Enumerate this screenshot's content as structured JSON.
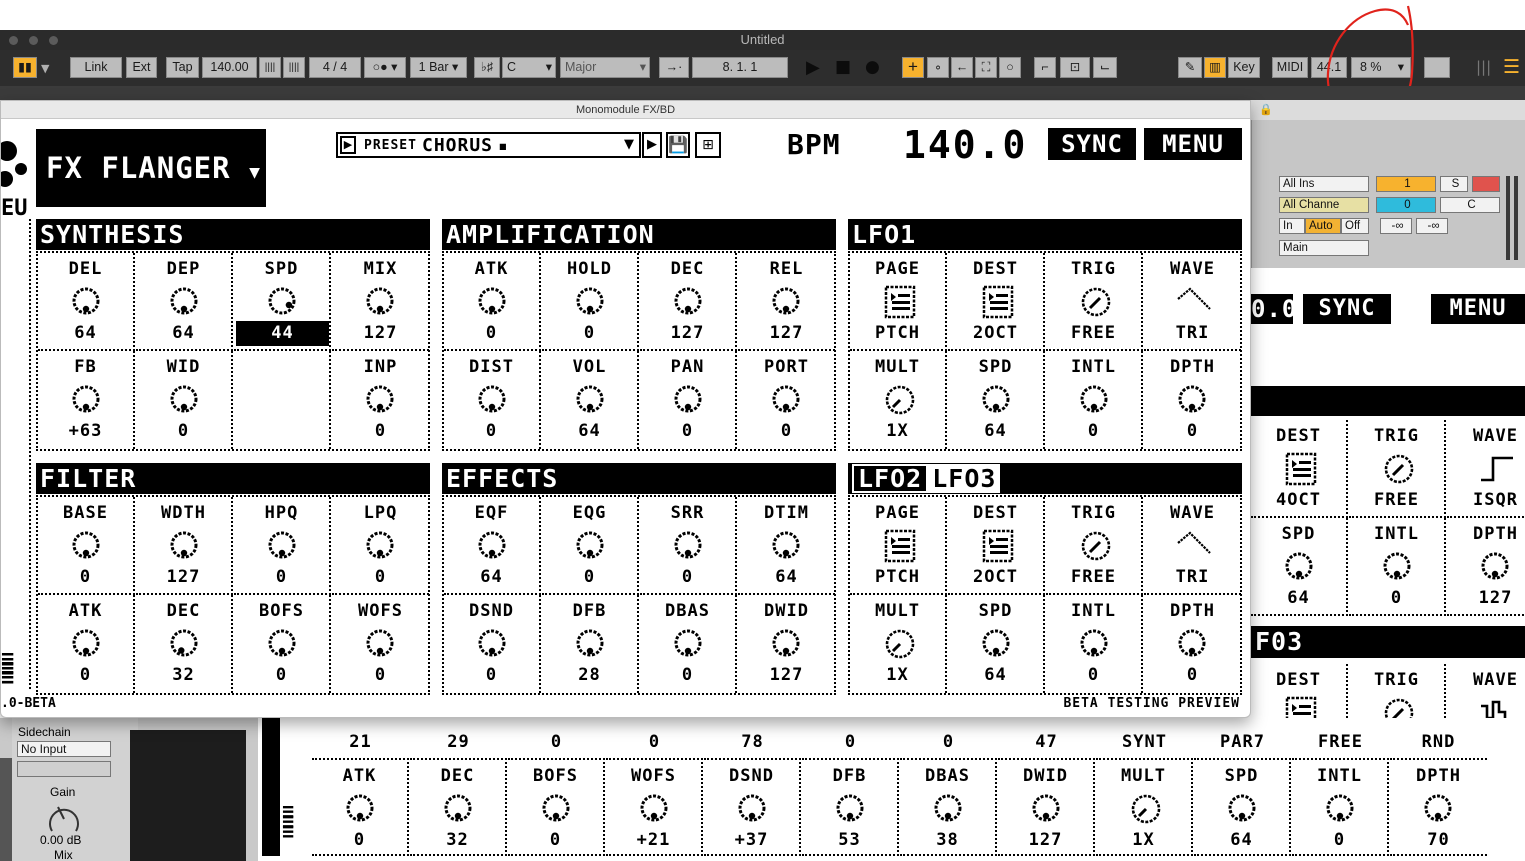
{
  "window": {
    "title": "Untitled"
  },
  "transport": {
    "link": "Link",
    "ext": "Ext",
    "tap": "Tap",
    "tempo": "140.00",
    "meter_num": "4",
    "meter_sep": "/",
    "meter_den": "4",
    "metro_glyph": "○●",
    "quantize": "1 Bar",
    "key_glyph": "♭♯",
    "scale_root": "C",
    "scale_mode": "Major",
    "position": "8.   1.   1",
    "key_btn": "Key",
    "midi_btn": "MIDI",
    "sample_rate": "44.1",
    "cpu": "8 %"
  },
  "plugin": {
    "window_title": "Monomodule FX/BD",
    "device_name": "FX FLANGER",
    "preset_label": "PRESET",
    "preset_value": "CHORUS",
    "bpm_label": "BPM",
    "bpm_value": "140.0",
    "sync_label": "SYNC",
    "menu_label": "MENU",
    "footer_left": ".0-BETA",
    "footer_right": "BETA TESTING PREVIEW",
    "sections": {
      "synthesis": {
        "title": "SYNTHESIS",
        "cells": [
          {
            "label": "DEL",
            "value": "64"
          },
          {
            "label": "DEP",
            "value": "64"
          },
          {
            "label": "SPD",
            "value": "44"
          },
          {
            "label": "MIX",
            "value": "127"
          },
          {
            "label": "FB",
            "value": "+63"
          },
          {
            "label": "WID",
            "value": "0"
          },
          {
            "label": "",
            "value": ""
          },
          {
            "label": "INP",
            "value": "0"
          }
        ]
      },
      "amplification": {
        "title": "AMPLIFICATION",
        "cells": [
          {
            "label": "ATK",
            "value": "0"
          },
          {
            "label": "HOLD",
            "value": "0"
          },
          {
            "label": "DEC",
            "value": "127"
          },
          {
            "label": "REL",
            "value": "127"
          },
          {
            "label": "DIST",
            "value": "0"
          },
          {
            "label": "VOL",
            "value": "64"
          },
          {
            "label": "PAN",
            "value": "0"
          },
          {
            "label": "PORT",
            "value": "0"
          }
        ]
      },
      "lfo1": {
        "title": "LFO1",
        "cells": [
          {
            "label": "PAGE",
            "value": "PTCH"
          },
          {
            "label": "DEST",
            "value": "2OCT"
          },
          {
            "label": "TRIG",
            "value": "FREE"
          },
          {
            "label": "WAVE",
            "value": "TRI"
          },
          {
            "label": "MULT",
            "value": "1X"
          },
          {
            "label": "SPD",
            "value": "64"
          },
          {
            "label": "INTL",
            "value": "0"
          },
          {
            "label": "DPTH",
            "value": "0"
          }
        ]
      },
      "filter": {
        "title": "FILTER",
        "cells": [
          {
            "label": "BASE",
            "value": "0"
          },
          {
            "label": "WDTH",
            "value": "127"
          },
          {
            "label": "HPQ",
            "value": "0"
          },
          {
            "label": "LPQ",
            "value": "0"
          },
          {
            "label": "ATK",
            "value": "0"
          },
          {
            "label": "DEC",
            "value": "32"
          },
          {
            "label": "BOFS",
            "value": "0"
          },
          {
            "label": "WOFS",
            "value": "0"
          }
        ]
      },
      "effects": {
        "title": "EFFECTS",
        "cells": [
          {
            "label": "EQF",
            "value": "64"
          },
          {
            "label": "EQG",
            "value": "0"
          },
          {
            "label": "SRR",
            "value": "0"
          },
          {
            "label": "DTIM",
            "value": "64"
          },
          {
            "label": "DSND",
            "value": "0"
          },
          {
            "label": "DFB",
            "value": "28"
          },
          {
            "label": "DBAS",
            "value": "0"
          },
          {
            "label": "DWID",
            "value": "127"
          }
        ]
      },
      "lfo23": {
        "tab1": "LFO2",
        "tab2": "LFO3",
        "cells": [
          {
            "label": "PAGE",
            "value": "PTCH"
          },
          {
            "label": "DEST",
            "value": "2OCT"
          },
          {
            "label": "TRIG",
            "value": "FREE"
          },
          {
            "label": "WAVE",
            "value": "TRI"
          },
          {
            "label": "MULT",
            "value": "1X"
          },
          {
            "label": "SPD",
            "value": "64"
          },
          {
            "label": "INTL",
            "value": "0"
          },
          {
            "label": "DPTH",
            "value": "0"
          }
        ]
      }
    }
  },
  "mixer": {
    "input_type": "All Ins",
    "input_channel": "All Channe",
    "monitor_in": "In",
    "monitor_auto": "Auto",
    "monitor_off": "Off",
    "output": "Main",
    "track_num": "1",
    "solo": "S",
    "send_val": "0",
    "pan": "C",
    "vol_a": "-∞",
    "vol_b": "-∞"
  },
  "background_plugin": {
    "bpm_value": "0.0",
    "sync_label": "SYNC",
    "menu_label": "MENU",
    "top_cells": [
      {
        "label": "DEST",
        "value": "4OCT"
      },
      {
        "label": "TRIG",
        "value": "FREE"
      },
      {
        "label": "WAVE",
        "value": "ISQR"
      },
      {
        "label": "SPD",
        "value": "64"
      },
      {
        "label": "INTL",
        "value": "0"
      },
      {
        "label": "DPTH",
        "value": "127"
      }
    ],
    "lfo3_title": "F03",
    "lfo3_cells": [
      {
        "label": "DEST",
        "value": "PAR7"
      },
      {
        "label": "TRIG",
        "value": "FREE"
      },
      {
        "label": "WAVE",
        "value": "RND"
      }
    ],
    "bottom_values": [
      "21",
      "29",
      "0",
      "0",
      "78",
      "0",
      "0",
      "47",
      "SYNT",
      "PAR7",
      "FREE",
      "RND"
    ],
    "bottom_cells": [
      {
        "label": "ATK",
        "value": "0"
      },
      {
        "label": "DEC",
        "value": "32"
      },
      {
        "label": "BOFS",
        "value": "0"
      },
      {
        "label": "WOFS",
        "value": "+21"
      },
      {
        "label": "DSND",
        "value": "+37"
      },
      {
        "label": "DFB",
        "value": "53"
      },
      {
        "label": "DBAS",
        "value": "38"
      },
      {
        "label": "DWID",
        "value": "127"
      },
      {
        "label": "MULT",
        "value": "1X"
      },
      {
        "label": "SPD",
        "value": "64"
      },
      {
        "label": "INTL",
        "value": "0"
      },
      {
        "label": "DPTH",
        "value": "70"
      }
    ]
  },
  "sidechain": {
    "label": "Sidechain",
    "input": "No Input",
    "gain_label": "Gain",
    "gain_value": "0.00 dB",
    "mix_label": "Mix"
  }
}
